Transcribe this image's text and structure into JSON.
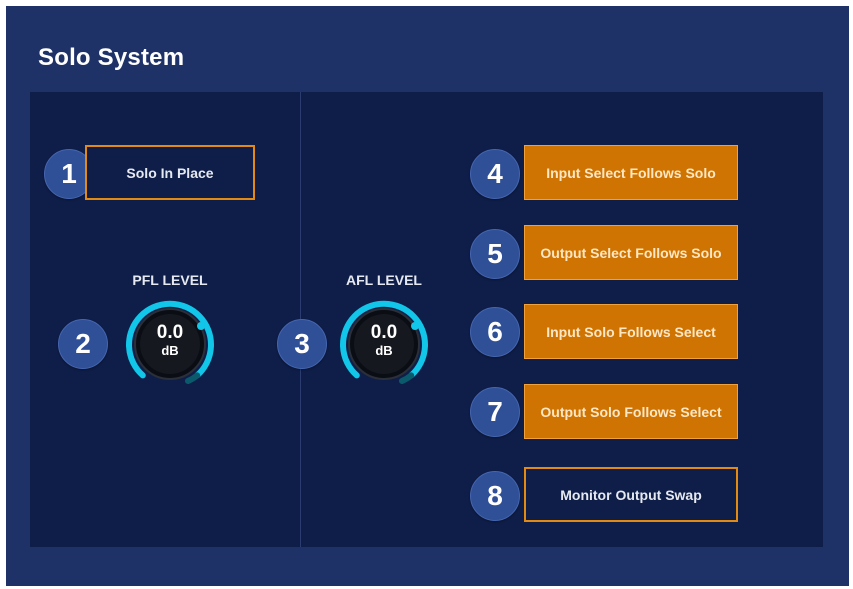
{
  "panel": {
    "title": "Solo System"
  },
  "badges": [
    "1",
    "2",
    "3",
    "4",
    "5",
    "6",
    "7",
    "8"
  ],
  "buttons": {
    "solo_in_place": "Solo In Place",
    "input_select_follows_solo": "Input Select Follows Solo",
    "output_select_follows_solo": "Output Select Follows Solo",
    "input_solo_follows_select": "Input Solo Follows Select",
    "output_solo_follows_select": "Output Solo Follows Select",
    "monitor_output_swap": "Monitor Output Swap"
  },
  "knobs": {
    "pfl": {
      "label": "PFL LEVEL",
      "value": "0.0",
      "unit": "dB"
    },
    "afl": {
      "label": "AFL LEVEL",
      "value": "0.0",
      "unit": "dB"
    }
  },
  "colors": {
    "panel_bg": "#1f3268",
    "inner_bg": "#0f1e49",
    "accent_orange": "#cf7402",
    "badge_blue": "#2f4f97",
    "knob_cyan": "#11c6e8"
  }
}
